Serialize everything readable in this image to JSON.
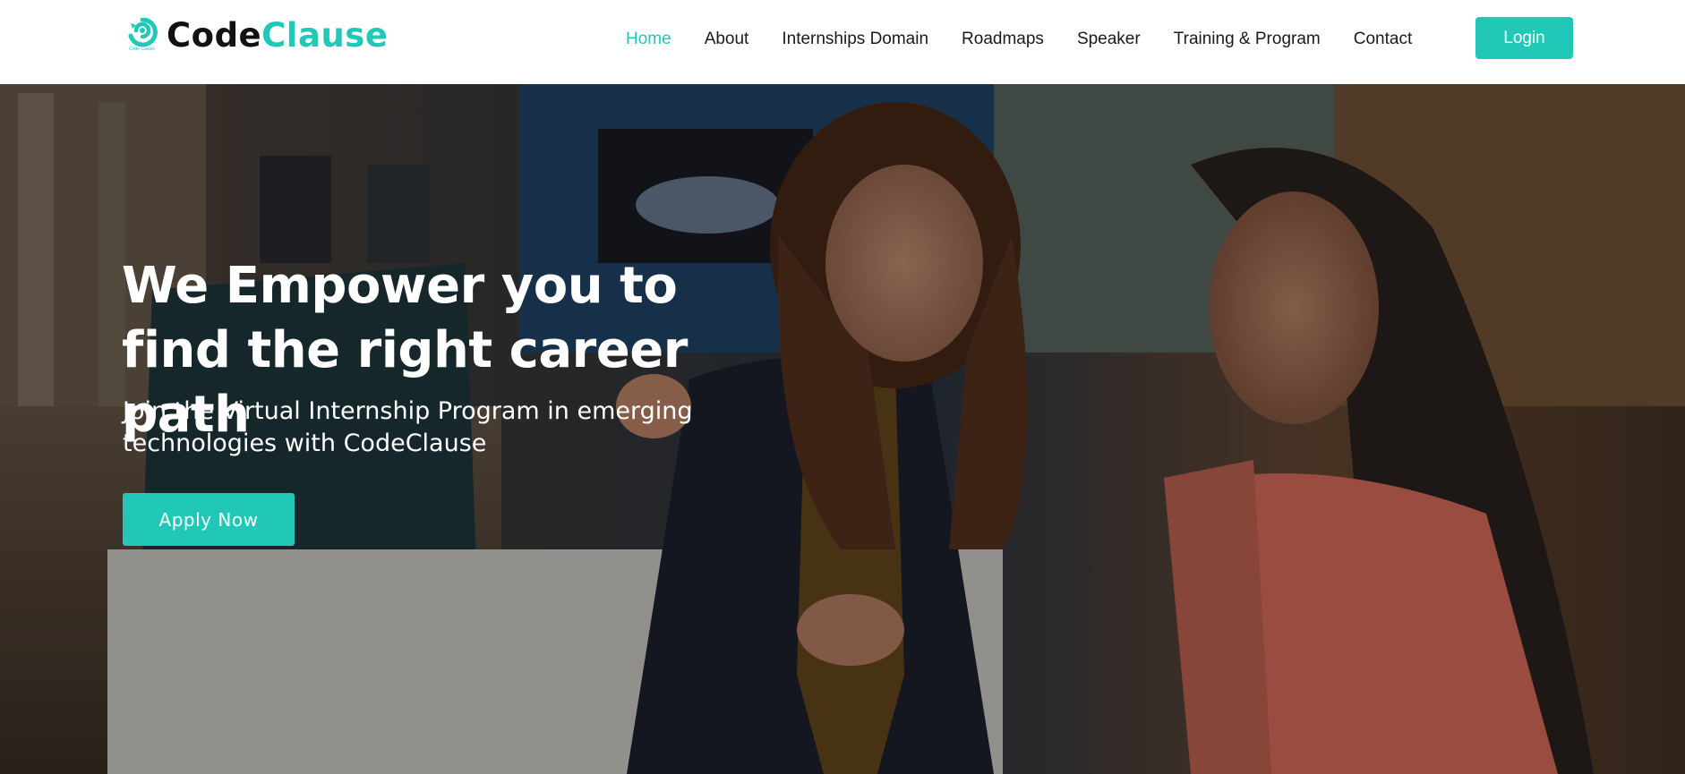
{
  "brand": {
    "name_part1": "Code",
    "name_part2": "Clause",
    "logo_small_text": "Code Clause",
    "accent_color": "#21c8b7",
    "logo_icon": "swirl-logo-icon"
  },
  "nav": {
    "items": [
      {
        "label": "Home",
        "active": true
      },
      {
        "label": "About",
        "active": false
      },
      {
        "label": "Internships Domain",
        "active": false
      },
      {
        "label": "Roadmaps",
        "active": false
      },
      {
        "label": "Speaker",
        "active": false
      },
      {
        "label": "Training & Program",
        "active": false
      },
      {
        "label": "Contact",
        "active": false
      }
    ],
    "login_label": "Login"
  },
  "hero": {
    "title": "We Empower you to find the right career path",
    "subtitle": "Join the Virtual Internship Program in emerging technologies with CodeClause",
    "cta_label": "Apply Now"
  }
}
